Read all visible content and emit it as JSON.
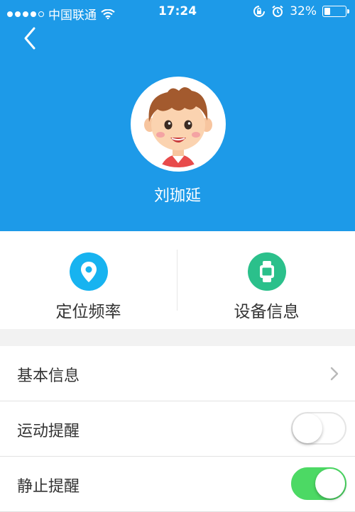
{
  "status_bar": {
    "carrier": "中国联通",
    "time": "17:24",
    "battery_text": "32%",
    "battery_level": 0.32
  },
  "profile": {
    "name": "刘珈延"
  },
  "quick_actions": [
    {
      "label": "定位频率",
      "icon": "location-pin-icon",
      "color": "#17b3f0"
    },
    {
      "label": "设备信息",
      "icon": "watch-icon",
      "color": "#2bc08b"
    }
  ],
  "settings": [
    {
      "title": "基本信息",
      "control": "chevron"
    },
    {
      "title": "运动提醒",
      "control": "toggle",
      "on": false
    },
    {
      "title": "静止提醒",
      "control": "toggle",
      "on": true
    }
  ],
  "colors": {
    "header": "#1d9ae8",
    "toggle_on": "#4cd964"
  }
}
